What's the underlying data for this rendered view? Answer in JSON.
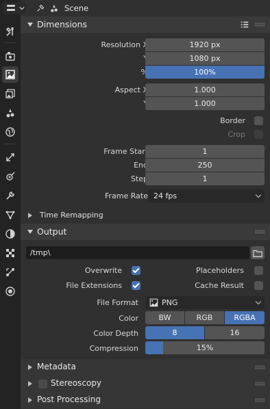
{
  "header": {
    "scene_label": "Scene"
  },
  "tabs": {
    "icons": [
      "tool-icon",
      "render-icon",
      "output-icon",
      "view-layer-icon",
      "scene-icon",
      "world-icon",
      "object-icon",
      "modifier-icon",
      "particles-icon",
      "physics-icon",
      "constraints-icon",
      "data-icon",
      "material-icon",
      "texture-icon"
    ],
    "active": "output-icon"
  },
  "dimensions": {
    "title": "Dimensions",
    "resolution_x_label": "Resolution X",
    "resolution_x": "1920 px",
    "resolution_y_label": "Y",
    "resolution_y": "1080 px",
    "percent_label": "%",
    "percent": "100%",
    "aspect_x_label": "Aspect X",
    "aspect_x": "1.000",
    "aspect_y_label": "Y",
    "aspect_y": "1.000",
    "border_label": "Border",
    "crop_label": "Crop",
    "frame_start_label": "Frame Start",
    "frame_start": "1",
    "end_label": "End",
    "end": "250",
    "step_label": "Step",
    "step": "1",
    "frame_rate_label": "Frame Rate",
    "frame_rate": "24 fps",
    "time_remapping": "Time Remapping"
  },
  "output": {
    "title": "Output",
    "path": "/tmp\\",
    "overwrite_label": "Overwrite",
    "placeholders_label": "Placeholders",
    "file_extensions_label": "File Extensions",
    "cache_result_label": "Cache Result",
    "file_format_label": "File Format",
    "file_format": "PNG",
    "color_label": "Color",
    "color_options": [
      "BW",
      "RGB",
      "RGBA"
    ],
    "color_selected": "RGBA",
    "color_depth_label": "Color Depth",
    "color_depth_options": [
      "8",
      "16"
    ],
    "color_depth_selected": "8",
    "compression_label": "Compression",
    "compression": "15%",
    "compression_fraction": 0.15
  },
  "collapsed_panels": [
    "Metadata",
    "Stereoscopy",
    "Post Processing"
  ],
  "colors": {
    "accent": "#4772b3",
    "arrow": "#e8383d"
  }
}
